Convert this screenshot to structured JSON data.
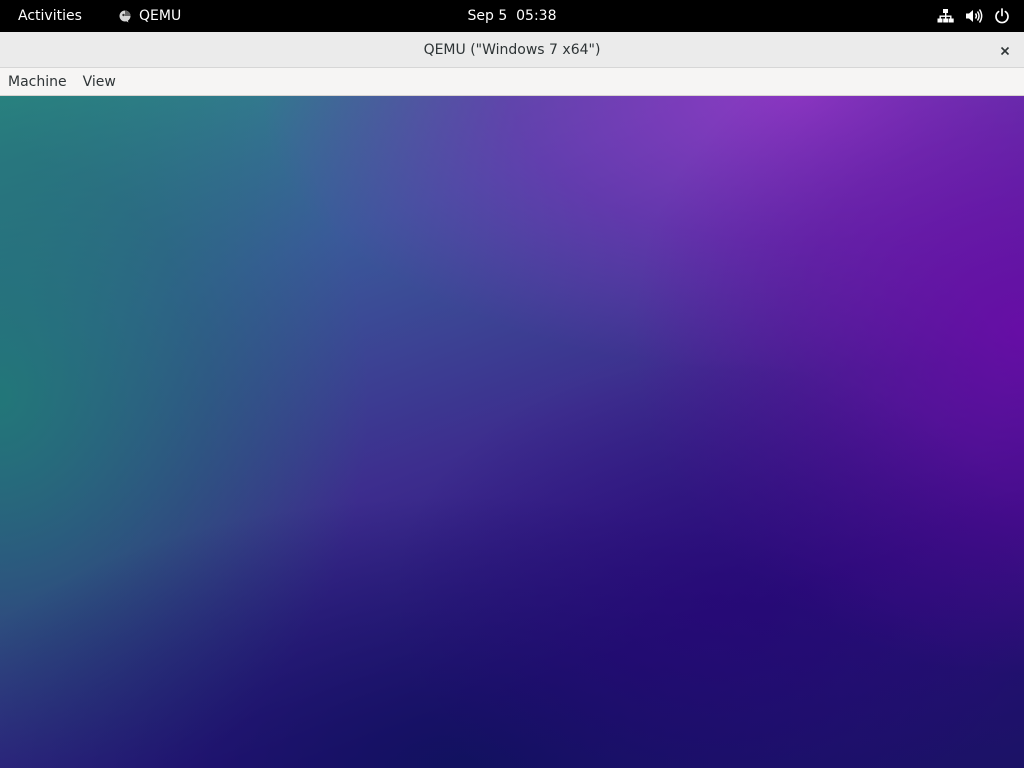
{
  "topbar": {
    "activities_label": "Activities",
    "app_menu": {
      "icon": "qemu-app-icon",
      "label": "QEMU"
    },
    "clock": "Sep 5  05:38",
    "tray": {
      "icons": [
        "network-wired-icon",
        "volume-icon",
        "power-icon"
      ]
    }
  },
  "window": {
    "title": "QEMU (\"Windows 7 x64\")",
    "close_icon": "close-icon"
  },
  "menubar": {
    "items": [
      {
        "label": "Machine"
      },
      {
        "label": "View"
      }
    ]
  },
  "guest_display": {
    "content": "gradient-wallpaper",
    "colors": {
      "teal": "#2d8a86",
      "purple": "#8a35c0",
      "violet": "#5b0aa0",
      "navy": "#12166a"
    }
  },
  "colors": {
    "topbar_bg": "#000000",
    "titlebar_bg": "#ebebeb",
    "menubar_bg": "#f6f5f4",
    "text_dark": "#2e3436"
  }
}
